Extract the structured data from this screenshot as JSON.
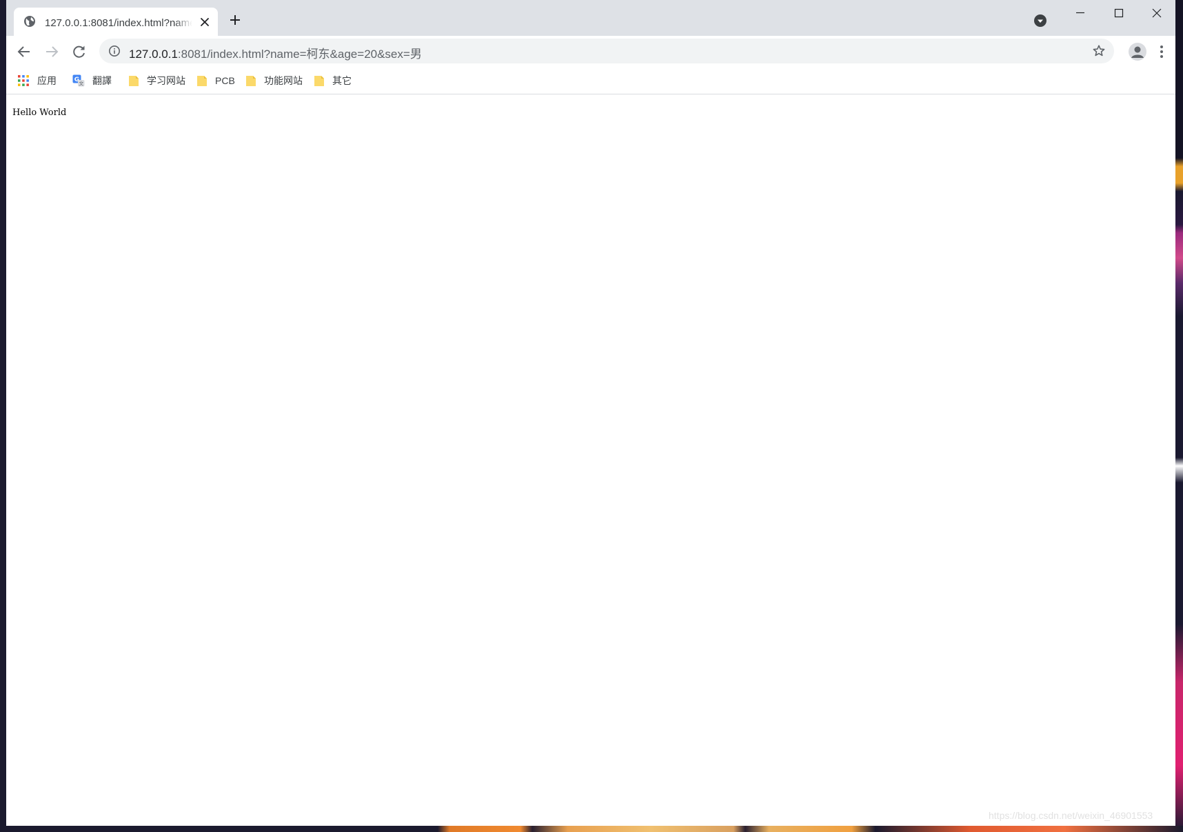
{
  "browser": {
    "tab": {
      "title": "127.0.0.1:8081/index.html?name=柯东&age=20&sex=男"
    },
    "address": {
      "host": "127.0.0.1",
      "rest": ":8081/index.html?name=柯东&age=20&sex=男"
    },
    "bookmarks": [
      {
        "label": "应用",
        "icon": "apps-grid-icon"
      },
      {
        "label": "翻譯",
        "icon": "translate-icon"
      },
      {
        "label": "学习网站",
        "icon": "folder-icon"
      },
      {
        "label": "PCB",
        "icon": "folder-icon"
      },
      {
        "label": "功能网站",
        "icon": "folder-icon"
      },
      {
        "label": "其它",
        "icon": "folder-icon"
      }
    ]
  },
  "page": {
    "body_text": "Hello World"
  },
  "watermark": "https://blog.csdn.net/weixin_46901553",
  "colors": {
    "tabstrip": "#dee1e6",
    "omnibox": "#f1f3f4",
    "folder": "#fbd96a",
    "icon_gray": "#5f6368"
  }
}
